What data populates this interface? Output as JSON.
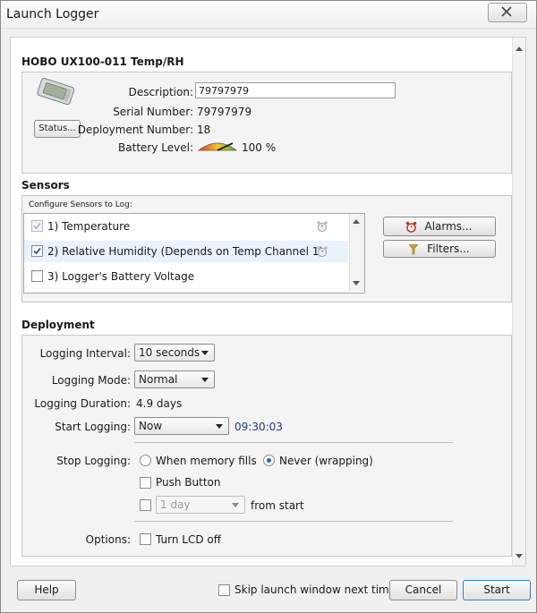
{
  "window": {
    "title": "Launch Logger",
    "close_label": "X"
  },
  "device": {
    "name": "HOBO UX100-011  Temp/RH",
    "description_label": "Description:",
    "description_value": "79797979",
    "serial_label": "Serial Number:",
    "serial_value": "79797979",
    "deployment_label": "Deployment Number:",
    "deployment_value": "18",
    "battery_label": "Battery Level:",
    "battery_value": "100 %",
    "battery_level": 1.0,
    "status_button": "Status..."
  },
  "sensors": {
    "section_title": "Sensors",
    "configure_label": "Configure Sensors to Log:",
    "items": [
      {
        "label": "1)  Temperature",
        "checked": true,
        "disabled": true,
        "alarm_icon": "bell-icon"
      },
      {
        "label": "2)  Relative Humidity (Depends on Temp Channel 1)",
        "checked": true,
        "disabled": false,
        "alarm_icon": "bell-icon"
      },
      {
        "label": "3)  Logger's Battery Voltage",
        "checked": false,
        "disabled": false
      }
    ],
    "alarms_button": "Alarms...",
    "filters_button": "Filters..."
  },
  "deployment": {
    "section_title": "Deployment",
    "interval_label": "Logging Interval:",
    "interval_value": "10 seconds",
    "mode_label": "Logging Mode:",
    "mode_value": "Normal",
    "duration_label": "Logging Duration:",
    "duration_value": "4.9 days",
    "start_label": "Start Logging:",
    "start_value": "Now",
    "start_time": "09:30:03",
    "stop_label": "Stop Logging:",
    "stop_memory_fills": "When memory fills",
    "stop_never": "Never (wrapping)",
    "stop_selected": "never",
    "push_button_label": "Push Button",
    "duration_select_value": "1 day",
    "from_start_label": "from start",
    "options_label": "Options:",
    "lcd_off_label": "Turn LCD off"
  },
  "footer": {
    "help_button": "Help",
    "skip_label": "Skip launch window next time",
    "cancel_button": "Cancel",
    "start_button": "Start"
  },
  "colors": {
    "time_text": "#1f3b8f",
    "radio_dot": "#2a66c9",
    "accent_button_border": "#3c7fb1"
  }
}
